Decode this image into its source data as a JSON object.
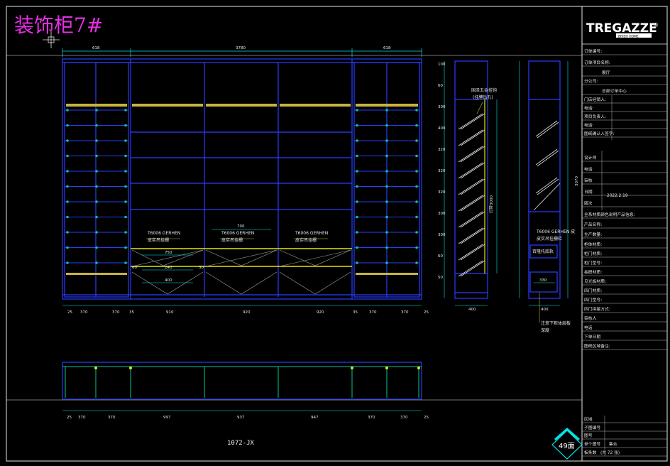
{
  "drawing": {
    "title": "装饰柜7#",
    "code": "1072-JX",
    "page_badge": "49面"
  },
  "brand": {
    "logo_text": "TREGAZZE",
    "registered": "®",
    "sub": "BRISH HOME"
  },
  "front_view": {
    "top_dims": [
      "618",
      "3780",
      "618"
    ],
    "bottom_dims": [
      "25",
      "370",
      "370",
      "35",
      "910",
      "920",
      "920",
      "35",
      "370",
      "370",
      "25"
    ],
    "inner_dims": [
      "700",
      "750",
      "240",
      "400",
      "60",
      "30"
    ],
    "tags": [
      {
        "code": "T6006 GERHEN",
        "desc": "皮实吊挂栅"
      },
      {
        "code": "T6006 GERHEN",
        "desc": "皮实吊挂栅"
      },
      {
        "code": "T6006 GERHEN",
        "desc": "皮实吊挂栅"
      }
    ]
  },
  "plan_view": {
    "dims": [
      "25",
      "370",
      "370",
      "997",
      "937",
      "947",
      "370",
      "370",
      "25"
    ]
  },
  "side_view_a": {
    "note_line1": "国泽五金挂钩",
    "note_line2": "(挂牌钻孔)",
    "side_label": "灯带3000",
    "dims_left": [
      "100",
      "60",
      "300",
      "400",
      "320",
      "320",
      "320",
      "300",
      "300",
      "60",
      "50"
    ],
    "bottom_dim": "400"
  },
  "side_view_b": {
    "total_height": "3070",
    "tag_code": "T6006 GERHEN 皮",
    "tag_desc": "皮实吊挂栅栏",
    "box_label": "百隆托底轨",
    "bottom_dim": "400",
    "inner_dim": "330",
    "note_line1": "注意下柜体层板",
    "note_line2": "深度"
  },
  "title_block": {
    "rows": [
      "订单编号:",
      "订单项目名称:",
      "展厅",
      "分公司:",
      "总部订单中心",
      "门店经销人:",
      "电话:",
      "项目负责人:",
      "电话:",
      "图纸确认人签字:",
      "设计师",
      "电话",
      "审核",
      "日期",
      "版次",
      "全系材质颜色说明产品信息:",
      "产品名称:",
      "生产数量:",
      "柜体材质:",
      "柜门材质:",
      "柜门型号:",
      "抽屉材质:",
      "见光板材质:",
      "四门材质:",
      "四门型号:",
      "四门拼接方式:",
      "审核人",
      "电话",
      "下单日期",
      "图纸区域备注:",
      "区域",
      "子图编号",
      "图号",
      "单个图号",
      "板条数"
    ],
    "date": "2022.2.19",
    "total_parts": "集合",
    "total_sheets": "(共 72 张)"
  }
}
